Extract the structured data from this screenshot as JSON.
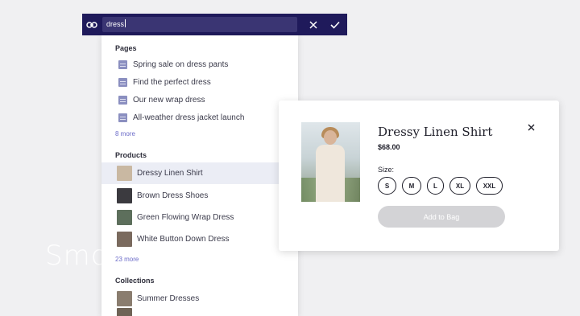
{
  "background": {
    "hero_text": "Smo"
  },
  "toolbar": {
    "link_icon": "link-icon",
    "search_value": "dress",
    "close_icon": "close-icon",
    "confirm_icon": "check-icon"
  },
  "dropdown": {
    "pages": {
      "title": "Pages",
      "items": [
        {
          "label": "Spring sale on dress pants",
          "icon": "page-icon"
        },
        {
          "label": "Find the perfect dress",
          "icon": "page-icon"
        },
        {
          "label": "Our new wrap dress",
          "icon": "page-icon"
        },
        {
          "label": "All-weather dress jacket launch",
          "icon": "page-icon"
        }
      ],
      "more": "8 more"
    },
    "products": {
      "title": "Products",
      "items": [
        {
          "label": "Dressy Linen Shirt",
          "highlighted": true,
          "thumb_color": "#c9b8a2"
        },
        {
          "label": "Brown Dress Shoes",
          "highlighted": false,
          "thumb_color": "#3b3a3f"
        },
        {
          "label": "Green Flowing Wrap Dress",
          "highlighted": false,
          "thumb_color": "#5d6f5c"
        },
        {
          "label": "White Button Down Dress",
          "highlighted": false,
          "thumb_color": "#7a6a5e"
        }
      ],
      "more": "23 more"
    },
    "collections": {
      "title": "Collections",
      "items": [
        {
          "label": "Summer Dresses",
          "thumb_color": "#8a7d6f"
        }
      ]
    }
  },
  "product_modal": {
    "title": "Dressy Linen Shirt",
    "price": "$68.00",
    "size_label": "Size:",
    "sizes": [
      "S",
      "M",
      "L",
      "XL",
      "XXL"
    ],
    "add_button": "Add to Bag",
    "close_icon": "close-icon"
  },
  "colors": {
    "toolbar_bg": "#1f1a5b",
    "input_bg": "#3a3573",
    "link_accent": "#6a6ac8",
    "highlight_row": "#ebedf5",
    "disabled_button": "#d3d3d6"
  }
}
